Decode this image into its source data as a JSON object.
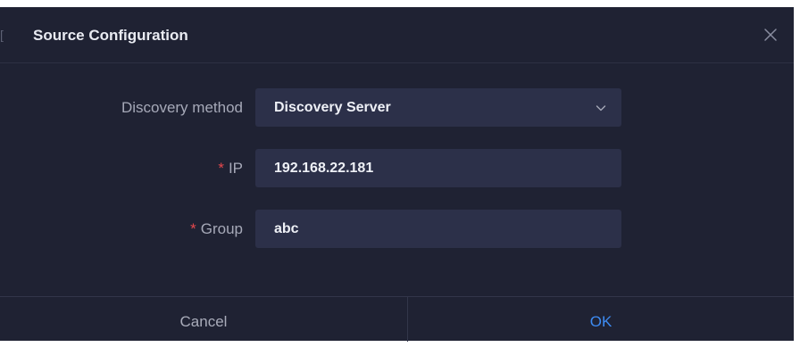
{
  "dialog": {
    "title": "Source Configuration",
    "close_icon": "close-icon"
  },
  "form": {
    "discovery_method": {
      "label": "Discovery method",
      "value": "Discovery Server",
      "icon": "chevron-down-icon"
    },
    "ip": {
      "required_mark": "*",
      "label": "IP",
      "value": "192.168.22.181"
    },
    "group": {
      "required_mark": "*",
      "label": "Group",
      "value": "abc"
    }
  },
  "footer": {
    "cancel_label": "Cancel",
    "ok_label": "OK"
  },
  "colors": {
    "background": "#1f2233",
    "field_background": "#2c3049",
    "required": "#e5484d",
    "accent": "#3d8bf2"
  }
}
